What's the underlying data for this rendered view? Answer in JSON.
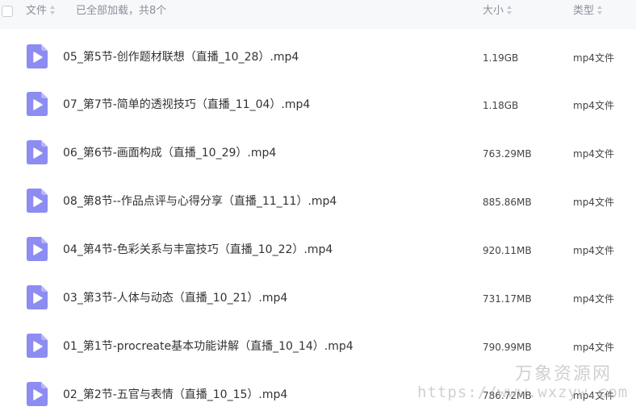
{
  "header": {
    "col_file": "文件",
    "status": "已全部加载，共8个",
    "col_size": "大小",
    "col_type": "类型"
  },
  "files": [
    {
      "name": "05_第5节-创作题材联想（直播_10_28）.mp4",
      "size": "1.19GB",
      "type": "mp4文件"
    },
    {
      "name": "07_第7节-简单的透视技巧（直播_11_04）.mp4",
      "size": "1.18GB",
      "type": "mp4文件"
    },
    {
      "name": "06_第6节-画面构成（直播_10_29）.mp4",
      "size": "763.29MB",
      "type": "mp4文件"
    },
    {
      "name": "08_第8节--作品点评与心得分享（直播_11_11）.mp4",
      "size": "885.86MB",
      "type": "mp4文件"
    },
    {
      "name": "04_第4节-色彩关系与丰富技巧（直播_10_22）.mp4",
      "size": "920.11MB",
      "type": "mp4文件"
    },
    {
      "name": "03_第3节-人体与动态（直播_10_21）.mp4",
      "size": "731.17MB",
      "type": "mp4文件"
    },
    {
      "name": "01_第1节-procreate基本功能讲解（直播_10_14）.mp4",
      "size": "790.99MB",
      "type": "mp4文件"
    },
    {
      "name": "02_第2节-五官与表情（直播_10_15）.mp4",
      "size": "786.72MB",
      "type": "mp4文件"
    }
  ],
  "icons": {
    "file": "video-file-icon",
    "checkbox": "select-all-checkbox",
    "sort": "sort-arrows-icon"
  },
  "colors": {
    "accent": "#8c8cf2",
    "header_bg": "#f7f8fa",
    "header_text": "#8a8f99",
    "text": "#333333"
  },
  "watermark": {
    "text_cn": "万象资源网",
    "url": "https://www.wxzyw.com"
  }
}
